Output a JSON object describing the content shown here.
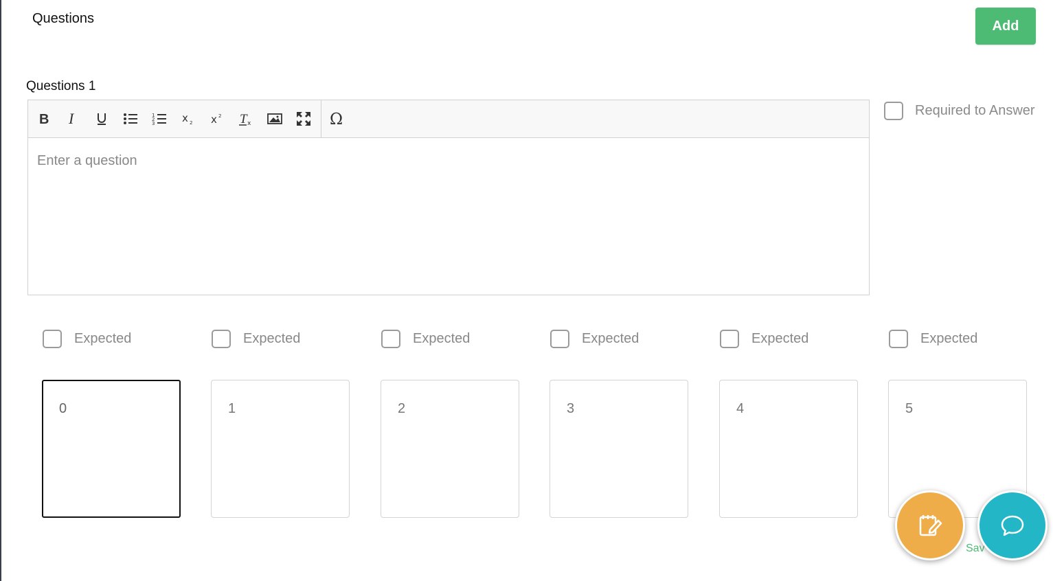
{
  "header": {
    "title": "Questions",
    "add_label": "Add"
  },
  "question": {
    "label": "Questions 1",
    "placeholder": "Enter a question",
    "required_label": "Required to Answer"
  },
  "toolbar": {
    "buttons": [
      "bold-icon",
      "italic-icon",
      "underline-icon",
      "bulleted-list-icon",
      "numbered-list-icon",
      "subscript-icon",
      "superscript-icon",
      "remove-format-icon",
      "image-icon",
      "maximize-icon",
      "special-character-icon"
    ]
  },
  "options": [
    {
      "expected_label": "Expected",
      "value": "0"
    },
    {
      "expected_label": "Expected",
      "value": "1"
    },
    {
      "expected_label": "Expected",
      "value": "2"
    },
    {
      "expected_label": "Expected",
      "value": "3"
    },
    {
      "expected_label": "Expected",
      "value": "4"
    },
    {
      "expected_label": "Expected",
      "value": "5"
    }
  ],
  "footer": {
    "save_partial": "Sav"
  },
  "colors": {
    "accent_green": "#4dbb74",
    "fab_orange": "#efad4a",
    "fab_teal": "#22b6c6"
  }
}
